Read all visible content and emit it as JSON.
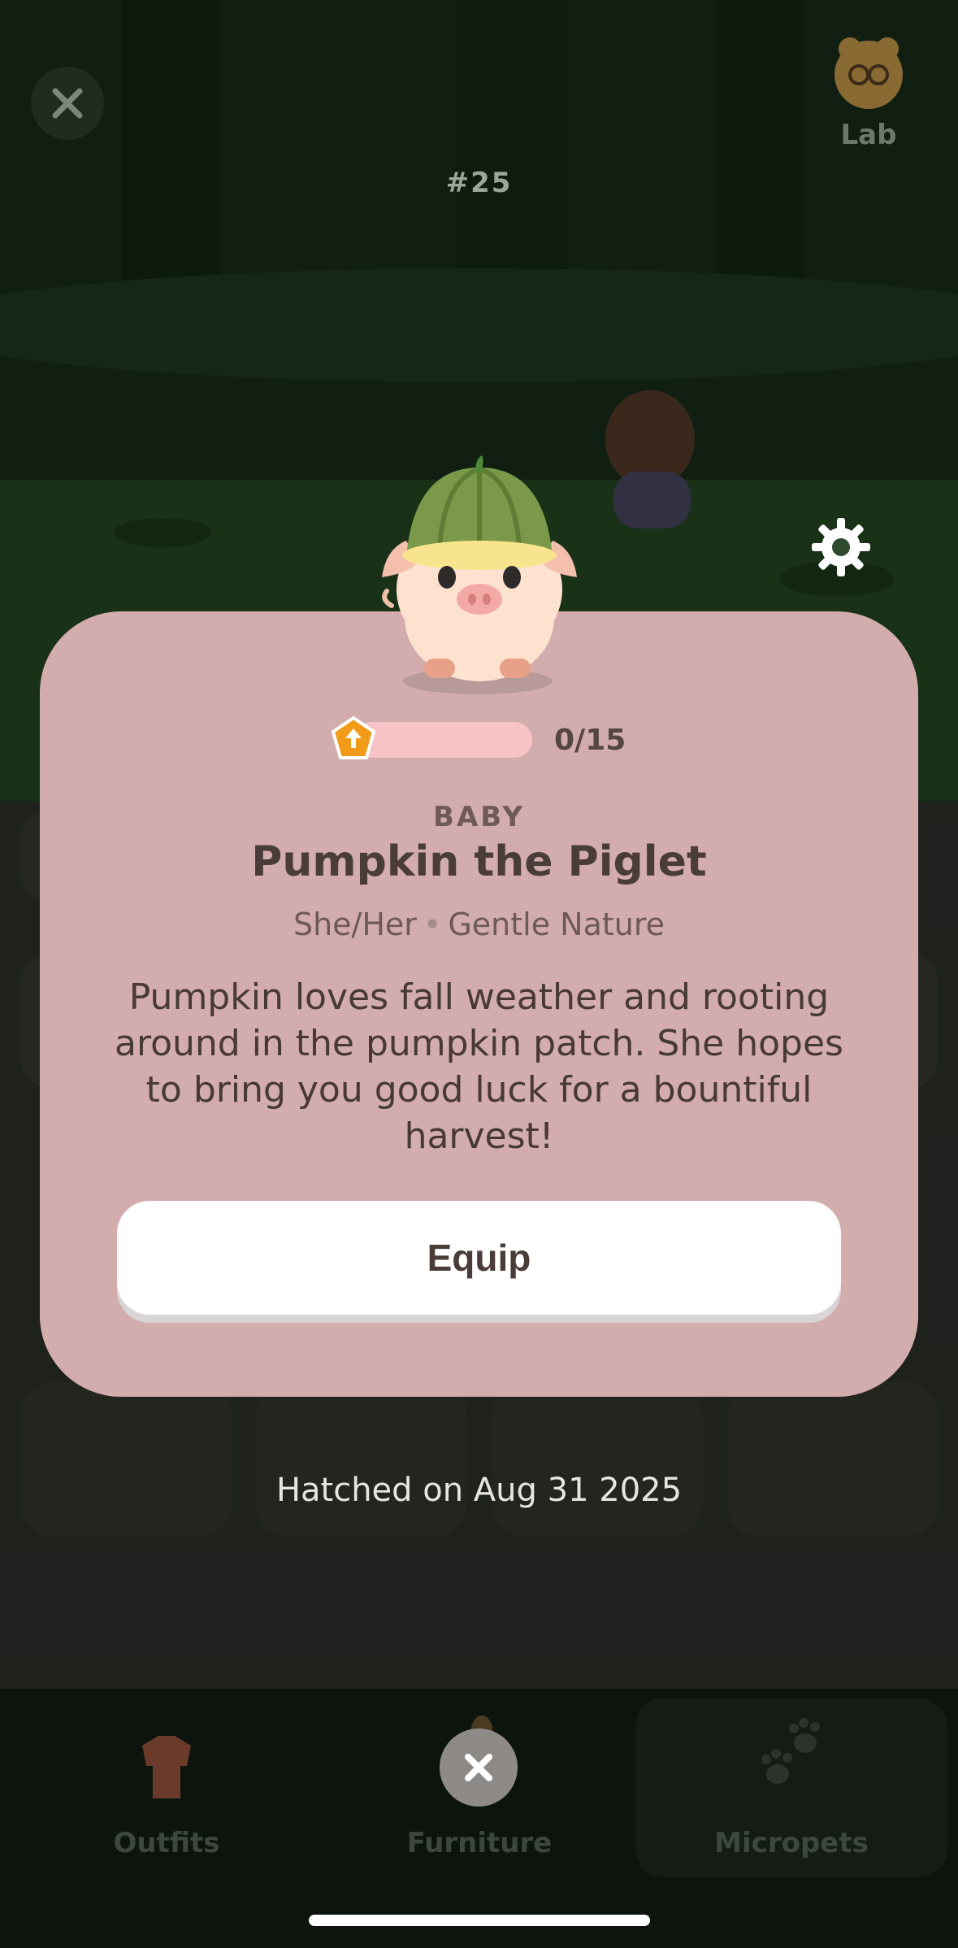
{
  "header": {
    "pet_number": "#25",
    "lab_label": "Lab"
  },
  "card": {
    "progress": {
      "current": 0,
      "max": 15,
      "text": "0/15"
    },
    "stage": "BABY",
    "name": "Pumpkin the Piglet",
    "pronouns": "She/Her",
    "nature": "Gentle Nature",
    "description": "Pumpkin loves fall weather and rooting around in the pumpkin patch. She hopes to bring you good luck for a bountiful harvest!",
    "equip_label": "Equip"
  },
  "hatched": "Hatched on Aug 31 2025",
  "tabs": [
    {
      "label": "Outfits",
      "icon": "outfits-icon"
    },
    {
      "label": "Furniture",
      "icon": "furniture-icon"
    },
    {
      "label": "Micropets",
      "icon": "paw-icon"
    }
  ],
  "colors": {
    "card_bg": "#d3adad",
    "progress_track": "#f6c3c6",
    "badge": "#f29b18",
    "equip_bg": "#ffffff"
  }
}
